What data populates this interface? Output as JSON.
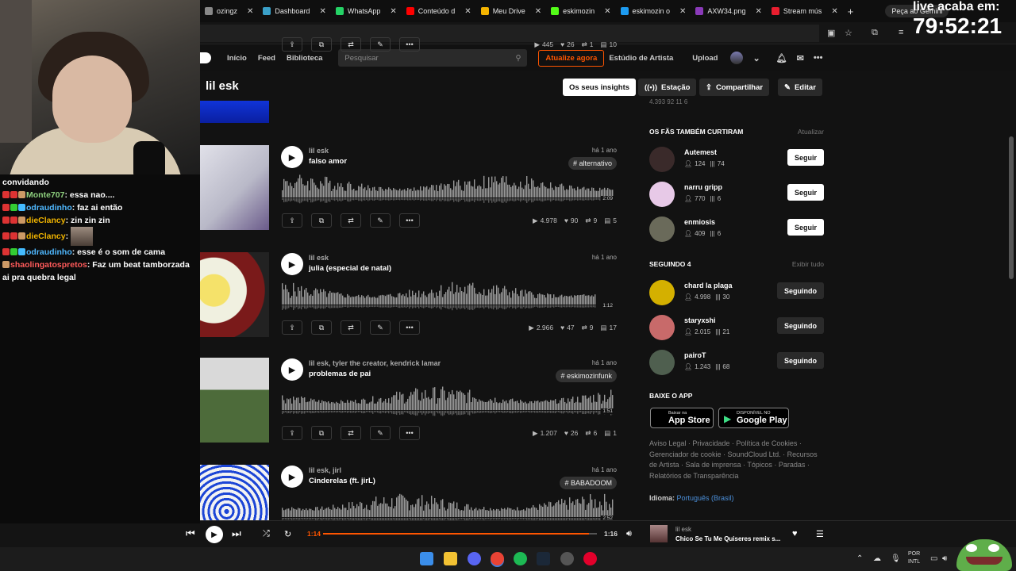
{
  "overlay": {
    "live_label": "live acaba em:",
    "live_timer": "79:52:21",
    "chat": [
      {
        "user": "",
        "color": "#ffffff",
        "text": "convidando",
        "badges": []
      },
      {
        "user": "Monte707",
        "color": "#8fd17f",
        "text": "essa nao....",
        "badges": [
          "#d33",
          "#d33",
          "#c96"
        ]
      },
      {
        "user": "odraudinho",
        "color": "#4fb8ff",
        "text": "faz ai então",
        "badges": [
          "#d33",
          "#3c3",
          "#4bf"
        ]
      },
      {
        "user": "dieClancy",
        "color": "#f0b400",
        "text": "zin zin zin",
        "badges": [
          "#d33",
          "#d33",
          "#c96"
        ]
      },
      {
        "user": "dieClancy",
        "color": "#f0b400",
        "text": "",
        "badges": [
          "#d33",
          "#d33",
          "#c96"
        ],
        "avatar": true
      },
      {
        "user": "odraudinho",
        "color": "#4fb8ff",
        "text": "esse é o som de cama",
        "badges": [
          "#d33",
          "#3c3",
          "#4bf"
        ]
      },
      {
        "user": "shaolingatospretos",
        "color": "#ff5a5a",
        "text": "Faz um beat tamborzada ai pra quebra legal",
        "badges": [
          "#c96"
        ]
      }
    ]
  },
  "browser": {
    "tabs": [
      {
        "label": "ozingz",
        "color": "#888"
      },
      {
        "label": "Dashboard",
        "color": "#3aa0c8"
      },
      {
        "label": "WhatsApp",
        "color": "#25d366"
      },
      {
        "label": "Conteúdo d",
        "color": "#ff0000"
      },
      {
        "label": "Meu Drive",
        "color": "#f4b400"
      },
      {
        "label": "eskimozin",
        "color": "#53fc18"
      },
      {
        "label": "eskimozin o",
        "color": "#1d9bf0"
      },
      {
        "label": "AXW34.png",
        "color": "#8a3ab9"
      },
      {
        "label": "Stream mús",
        "color": "#e91e2f"
      }
    ],
    "new_tab": "+",
    "gemini": "Peça ao Gemini"
  },
  "sc": {
    "nav": [
      "Início",
      "Feed",
      "Biblioteca"
    ],
    "search_placeholder": "Pesquisar",
    "upgrade": "Atualize agora",
    "artist_studio": "Estúdio de Artista",
    "upload": "Upload"
  },
  "profile": {
    "name": "lil esk",
    "buttons": {
      "insights": "Os seus insights",
      "station": "Estação",
      "share": "Compartilhar",
      "edit": "Editar"
    }
  },
  "tracks": [
    {
      "artist": "",
      "title": "",
      "age": "",
      "tag": "",
      "duration": "",
      "plays": "445",
      "likes": "26",
      "reposts": "1",
      "comments": "10",
      "partial": true
    },
    {
      "artist": "lil esk",
      "title": "falso amor",
      "age": "há 1 ano",
      "tag": "# alternativo",
      "duration": "2:09",
      "plays": "4.978",
      "likes": "90",
      "reposts": "9",
      "comments": "5"
    },
    {
      "artist": "lil esk",
      "title": "julia (especial de natal)",
      "age": "há 1 ano",
      "tag": "",
      "duration": "1:12",
      "plays": "2.966",
      "likes": "47",
      "reposts": "9",
      "comments": "17"
    },
    {
      "artist": "lil esk, tyler the creator, kendrick lamar",
      "title": "problemas de pai",
      "age": "há 1 ano",
      "tag": "# eskimozinfunk",
      "duration": "1:51",
      "plays": "1.207",
      "likes": "26",
      "reposts": "6",
      "comments": "1"
    },
    {
      "artist": "lil esk, jirl",
      "title": "Cinderelas (ft. jirL)",
      "age": "há 1 ano",
      "tag": "# BABADOOM",
      "duration": "2:52",
      "plays": "",
      "likes": "",
      "reposts": "",
      "comments": ""
    }
  ],
  "sidebar": {
    "top_partial": "4.393   92   11   6",
    "fans_header": "OS FÃS TAMBÉM CURTIRAM",
    "refresh": "Atualizar",
    "fans": [
      {
        "name": "Autemest",
        "followers": "124",
        "tracks": "74",
        "button": "Seguir",
        "color": "#3a2a2a"
      },
      {
        "name": "narru gripp",
        "followers": "770",
        "tracks": "6",
        "button": "Seguir",
        "color": "#e7c9e7"
      },
      {
        "name": "enmiosis",
        "followers": "409",
        "tracks": "6",
        "button": "Seguir",
        "color": "#6a6a5a"
      }
    ],
    "following_header": "SEGUINDO 4",
    "view_all": "Exibir tudo",
    "following": [
      {
        "name": "chard la plaga",
        "followers": "4.998",
        "tracks": "30",
        "button": "Seguindo",
        "color": "#d4b000"
      },
      {
        "name": "staryxshi",
        "followers": "2.015",
        "tracks": "21",
        "button": "Seguindo",
        "color": "#c86a6a"
      },
      {
        "name": "pairoT",
        "followers": "1.243",
        "tracks": "68",
        "button": "Seguindo",
        "color": "#4f5f4f"
      }
    ],
    "app_header": "BAIXE O APP",
    "appstore": {
      "small": "Baixar na",
      "big": "App Store"
    },
    "googleplay": {
      "small": "DISPONÍVEL NO",
      "big": "Google Play"
    },
    "footer": "Aviso Legal · Privacidade · Política de Cookies · Gerenciador de cookie · SoundCloud Ltd. · Recursos de Artista · Sala de imprensa · Tópicos · Paradas · Relatórios de Transparência",
    "lang_label": "Idioma:",
    "lang_value": "Português (Brasil)"
  },
  "player": {
    "elapsed": "1:14",
    "total": "1:16",
    "progress": 0.97,
    "now_artist": "lil esk",
    "now_title": "Chico Se Tu Me Quiseres remix s..."
  },
  "taskbar": {
    "kbd_line1": "POR",
    "kbd_line2": "INTL"
  }
}
